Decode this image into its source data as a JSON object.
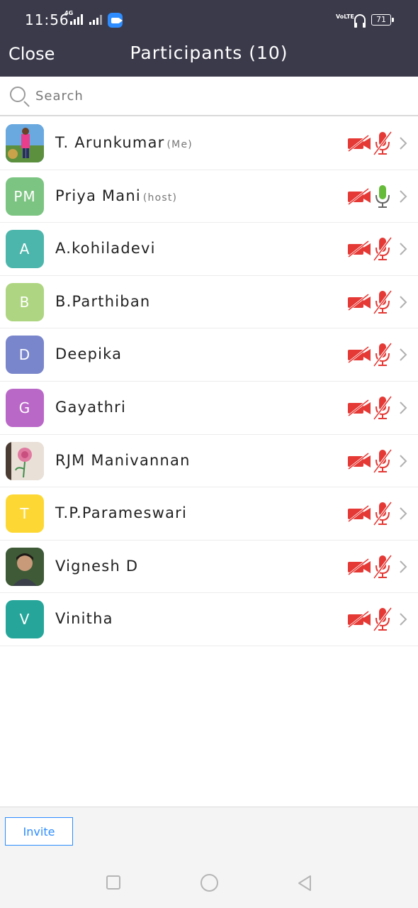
{
  "status_bar": {
    "time": "11:56",
    "network": "4G",
    "volte": "VoLTE",
    "battery": "71"
  },
  "header": {
    "close_label": "Close",
    "title": "Participants (10)"
  },
  "search": {
    "placeholder": "Search"
  },
  "participants": [
    {
      "name": "T. Arunkumar",
      "tag": "(Me)",
      "avatar_type": "photo",
      "initials": "",
      "avatar_color": "#4a7fb5",
      "video": "off",
      "audio": "muted"
    },
    {
      "name": "Priya Mani",
      "tag": "(host)",
      "avatar_type": "initials",
      "initials": "PM",
      "avatar_color": "#7cc481",
      "video": "off",
      "audio": "unmuted"
    },
    {
      "name": "A.kohiladevi",
      "tag": "",
      "avatar_type": "initials",
      "initials": "A",
      "avatar_color": "#4db6ac",
      "video": "off",
      "audio": "muted"
    },
    {
      "name": "B.Parthiban",
      "tag": "",
      "avatar_type": "initials",
      "initials": "B",
      "avatar_color": "#aed581",
      "video": "off",
      "audio": "muted"
    },
    {
      "name": "Deepika",
      "tag": "",
      "avatar_type": "initials",
      "initials": "D",
      "avatar_color": "#7986cb",
      "video": "off",
      "audio": "muted"
    },
    {
      "name": "Gayathri",
      "tag": "",
      "avatar_type": "initials",
      "initials": "G",
      "avatar_color": "#ba68c8",
      "video": "off",
      "audio": "muted"
    },
    {
      "name": "RJM Manivannan",
      "tag": "",
      "avatar_type": "photo",
      "initials": "",
      "avatar_color": "#d8c9c0",
      "video": "off",
      "audio": "muted"
    },
    {
      "name": "T.P.Parameswari",
      "tag": "",
      "avatar_type": "initials",
      "initials": "T",
      "avatar_color": "#fdd835",
      "video": "off",
      "audio": "muted"
    },
    {
      "name": "Vignesh D",
      "tag": "",
      "avatar_type": "photo",
      "initials": "",
      "avatar_color": "#3b4a3a",
      "video": "off",
      "audio": "muted"
    },
    {
      "name": "Vinitha",
      "tag": "",
      "avatar_type": "initials",
      "initials": "V",
      "avatar_color": "#26a69a",
      "video": "off",
      "audio": "muted"
    }
  ],
  "footer": {
    "invite_label": "Invite"
  },
  "colors": {
    "header_bg": "#3b3a4b",
    "muted_red": "#e53935",
    "active_green": "#66bb3a",
    "accent_blue": "#2d8cff"
  }
}
